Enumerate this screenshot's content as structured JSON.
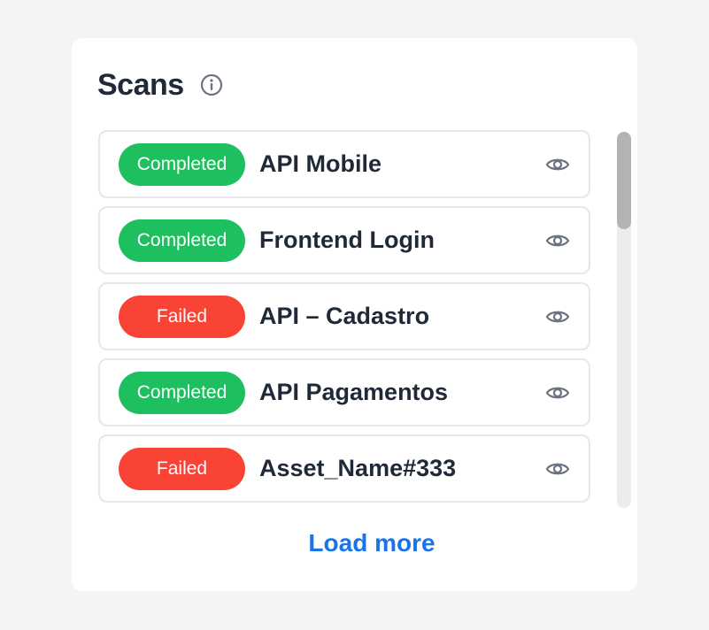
{
  "panel": {
    "title": "Scans",
    "info_icon": "info-icon",
    "load_more_label": "Load more"
  },
  "scans": [
    {
      "status": "Completed",
      "status_type": "completed",
      "name": "API Mobile",
      "action_icon": "eye-icon"
    },
    {
      "status": "Completed",
      "status_type": "completed",
      "name": "Frontend Login",
      "action_icon": "eye-icon"
    },
    {
      "status": "Failed",
      "status_type": "failed",
      "name": "API – Cadastro",
      "action_icon": "eye-icon"
    },
    {
      "status": "Completed",
      "status_type": "completed",
      "name": "API Pagamentos",
      "action_icon": "eye-icon"
    },
    {
      "status": "Failed",
      "status_type": "failed",
      "name": "Asset_Name#333",
      "action_icon": "eye-icon"
    }
  ],
  "colors": {
    "completed": "#1dbf5e",
    "failed": "#f94335",
    "link": "#1a73e8",
    "text": "#1f2937",
    "background": "#f3f4f6"
  }
}
